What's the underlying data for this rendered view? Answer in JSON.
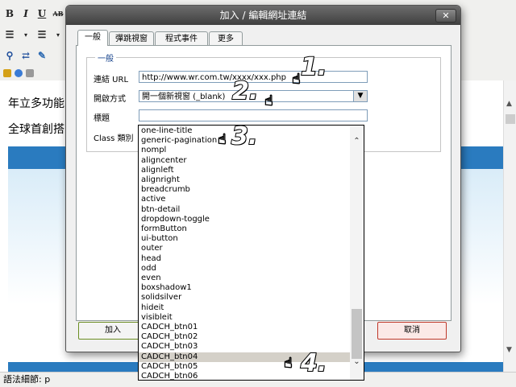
{
  "toolbar": {
    "bold": "B",
    "italic": "I",
    "underline": "U",
    "strike": "AB"
  },
  "editor": {
    "line1": "年立多功能",
    "line2": "全球首創搭"
  },
  "status_bar": {
    "text": "語法細節: p"
  },
  "dialog": {
    "title": "加入 / 編輯網址連結",
    "close_label": "✕",
    "tabs": [
      {
        "label": "一般",
        "active": true
      },
      {
        "label": "彈跳視窗",
        "active": false
      },
      {
        "label": "程式事件",
        "active": false
      },
      {
        "label": "更多",
        "active": false
      }
    ],
    "group_legend": "一般",
    "url_label": "連結 URL",
    "url_value": "http://www.wr.com.tw/xxxx/xxx.php",
    "target_label": "開啟方式",
    "target_value": "開一個新視窗 (_blank)",
    "title_label": "標題",
    "title_value": "",
    "class_label": "Class 類別",
    "insert_button": "加入",
    "cancel_button": "取消"
  },
  "class_list": {
    "items": [
      "one-line-title",
      "generic-pagination",
      "nompl",
      "aligncenter",
      "alignleft",
      "alignright",
      "breadcrumb",
      "active",
      "btn-detail",
      "dropdown-toggle",
      "formButton",
      "ui-button",
      "outer",
      "head",
      "odd",
      "even",
      "boxshadow1",
      "solidsilver",
      "hideit",
      "visibleit",
      "CADCH_btn01",
      "CADCH_btn02",
      "CADCH_btn03",
      "CADCH_btn04",
      "CADCH_btn05",
      "CADCH_btn06"
    ],
    "highlighted": "CADCH_btn04"
  },
  "annotations": {
    "step1": "1.",
    "step2": "2.",
    "step3": "3.",
    "step4": "4."
  },
  "colors": {
    "dialog_title_bg": "#4a4a4a",
    "banner_blue": "#2a7bbf",
    "highlight": "#d4d0c8",
    "cancel_button_border": "#c0392b",
    "insert_button_border": "#6b8e23"
  }
}
